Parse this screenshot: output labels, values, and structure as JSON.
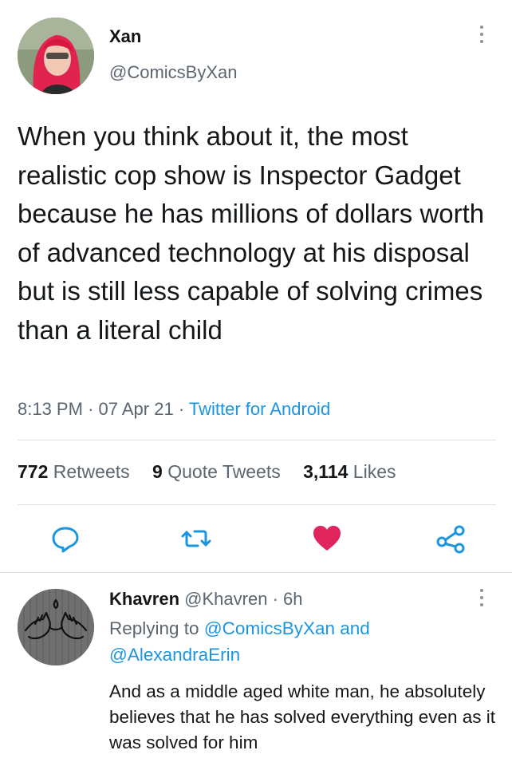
{
  "tweet": {
    "author_name": "Xan",
    "author_handle": "@ComicsByXan",
    "text": "When you think about it, the most realistic cop show is Inspector Gadget because he has millions of dollars worth of advanced technology at his disposal but is still less capable of solving crimes than a literal child",
    "time": "8:13 PM",
    "date": "07 Apr 21",
    "source": "Twitter for Android",
    "separator": "·",
    "stats": {
      "retweets_count": "772",
      "retweets_label": "Retweets",
      "quotes_count": "9",
      "quotes_label": "Quote Tweets",
      "likes_count": "3,114",
      "likes_label": "Likes"
    },
    "icons": {
      "reply": "reply-icon",
      "retweet": "retweet-icon",
      "like": "heart-icon",
      "share": "share-icon"
    },
    "like_color": "#e0245e"
  },
  "reply": {
    "author_name": "Khavren",
    "author_handle": "@Khavren",
    "separator": "·",
    "time_ago": "6h",
    "replying_prefix": "Replying to",
    "mention_1": "@ComicsByXan",
    "conjunction": "and",
    "mention_2": "@AlexandraErin",
    "text": "And as a middle aged white man, he absolutely believes that he has solved everything even as it was solved for him"
  },
  "colors": {
    "link": "#1b95e0",
    "secondary_text": "#5b6670",
    "primary_text": "#14171a"
  }
}
